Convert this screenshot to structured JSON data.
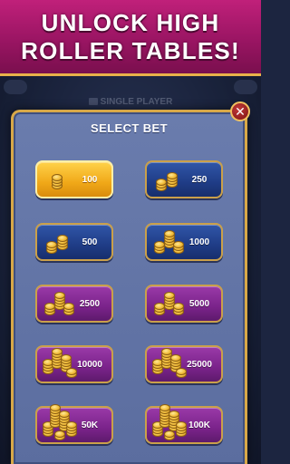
{
  "banner": {
    "line1": "UNLOCK HIGH",
    "line2": "ROLLER TABLES!"
  },
  "background": {
    "title": "SINGLE PLAYER"
  },
  "modal": {
    "title": "SELECT BET",
    "close_icon": "close-icon",
    "bets": [
      {
        "amount": "100",
        "color": "gold",
        "coin_stacks": 1
      },
      {
        "amount": "250",
        "color": "blue",
        "coin_stacks": 2
      },
      {
        "amount": "500",
        "color": "blue",
        "coin_stacks": 2
      },
      {
        "amount": "1000",
        "color": "blue",
        "coin_stacks": 3
      },
      {
        "amount": "2500",
        "color": "purple",
        "coin_stacks": 3
      },
      {
        "amount": "5000",
        "color": "purple",
        "coin_stacks": 3
      },
      {
        "amount": "10000",
        "color": "purple",
        "coin_stacks": 4
      },
      {
        "amount": "25000",
        "color": "purple",
        "coin_stacks": 4
      },
      {
        "amount": "50K",
        "color": "purple",
        "coin_stacks": 5
      },
      {
        "amount": "100K",
        "color": "purple",
        "coin_stacks": 5
      }
    ]
  },
  "colors": {
    "banner": "#9a1563",
    "frame_gold": "#d8a848",
    "modal_panel": "#5b6d9f",
    "button_gold": "#f0a818",
    "button_blue": "#1f3c86",
    "button_purple": "#7a238a"
  }
}
